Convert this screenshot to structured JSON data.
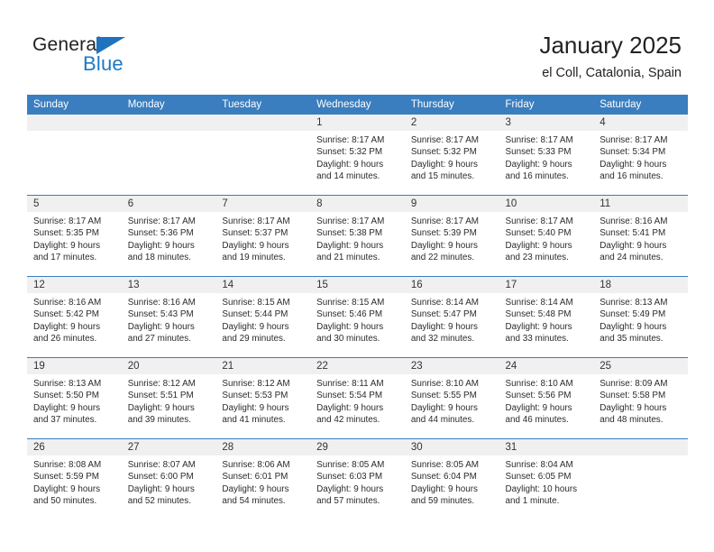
{
  "logo": {
    "word_top": "General",
    "word_bottom": "Blue",
    "triangle_color": "#1f72bd",
    "blue_text_color": "#1b79c4"
  },
  "header": {
    "title": "January 2025",
    "subtitle": "el Coll, Catalonia, Spain",
    "header_bg_color": "#3a7ebf",
    "daynum_bg_color": "#f0f0f0"
  },
  "weekday_headers": [
    "Sunday",
    "Monday",
    "Tuesday",
    "Wednesday",
    "Thursday",
    "Friday",
    "Saturday"
  ],
  "weeks": [
    [
      {
        "day": "",
        "lines": []
      },
      {
        "day": "",
        "lines": []
      },
      {
        "day": "",
        "lines": []
      },
      {
        "day": "1",
        "lines": [
          "Sunrise: 8:17 AM",
          "Sunset: 5:32 PM",
          "Daylight: 9 hours",
          "and 14 minutes."
        ]
      },
      {
        "day": "2",
        "lines": [
          "Sunrise: 8:17 AM",
          "Sunset: 5:32 PM",
          "Daylight: 9 hours",
          "and 15 minutes."
        ]
      },
      {
        "day": "3",
        "lines": [
          "Sunrise: 8:17 AM",
          "Sunset: 5:33 PM",
          "Daylight: 9 hours",
          "and 16 minutes."
        ]
      },
      {
        "day": "4",
        "lines": [
          "Sunrise: 8:17 AM",
          "Sunset: 5:34 PM",
          "Daylight: 9 hours",
          "and 16 minutes."
        ]
      }
    ],
    [
      {
        "day": "5",
        "lines": [
          "Sunrise: 8:17 AM",
          "Sunset: 5:35 PM",
          "Daylight: 9 hours",
          "and 17 minutes."
        ]
      },
      {
        "day": "6",
        "lines": [
          "Sunrise: 8:17 AM",
          "Sunset: 5:36 PM",
          "Daylight: 9 hours",
          "and 18 minutes."
        ]
      },
      {
        "day": "7",
        "lines": [
          "Sunrise: 8:17 AM",
          "Sunset: 5:37 PM",
          "Daylight: 9 hours",
          "and 19 minutes."
        ]
      },
      {
        "day": "8",
        "lines": [
          "Sunrise: 8:17 AM",
          "Sunset: 5:38 PM",
          "Daylight: 9 hours",
          "and 21 minutes."
        ]
      },
      {
        "day": "9",
        "lines": [
          "Sunrise: 8:17 AM",
          "Sunset: 5:39 PM",
          "Daylight: 9 hours",
          "and 22 minutes."
        ]
      },
      {
        "day": "10",
        "lines": [
          "Sunrise: 8:17 AM",
          "Sunset: 5:40 PM",
          "Daylight: 9 hours",
          "and 23 minutes."
        ]
      },
      {
        "day": "11",
        "lines": [
          "Sunrise: 8:16 AM",
          "Sunset: 5:41 PM",
          "Daylight: 9 hours",
          "and 24 minutes."
        ]
      }
    ],
    [
      {
        "day": "12",
        "lines": [
          "Sunrise: 8:16 AM",
          "Sunset: 5:42 PM",
          "Daylight: 9 hours",
          "and 26 minutes."
        ]
      },
      {
        "day": "13",
        "lines": [
          "Sunrise: 8:16 AM",
          "Sunset: 5:43 PM",
          "Daylight: 9 hours",
          "and 27 minutes."
        ]
      },
      {
        "day": "14",
        "lines": [
          "Sunrise: 8:15 AM",
          "Sunset: 5:44 PM",
          "Daylight: 9 hours",
          "and 29 minutes."
        ]
      },
      {
        "day": "15",
        "lines": [
          "Sunrise: 8:15 AM",
          "Sunset: 5:46 PM",
          "Daylight: 9 hours",
          "and 30 minutes."
        ]
      },
      {
        "day": "16",
        "lines": [
          "Sunrise: 8:14 AM",
          "Sunset: 5:47 PM",
          "Daylight: 9 hours",
          "and 32 minutes."
        ]
      },
      {
        "day": "17",
        "lines": [
          "Sunrise: 8:14 AM",
          "Sunset: 5:48 PM",
          "Daylight: 9 hours",
          "and 33 minutes."
        ]
      },
      {
        "day": "18",
        "lines": [
          "Sunrise: 8:13 AM",
          "Sunset: 5:49 PM",
          "Daylight: 9 hours",
          "and 35 minutes."
        ]
      }
    ],
    [
      {
        "day": "19",
        "lines": [
          "Sunrise: 8:13 AM",
          "Sunset: 5:50 PM",
          "Daylight: 9 hours",
          "and 37 minutes."
        ]
      },
      {
        "day": "20",
        "lines": [
          "Sunrise: 8:12 AM",
          "Sunset: 5:51 PM",
          "Daylight: 9 hours",
          "and 39 minutes."
        ]
      },
      {
        "day": "21",
        "lines": [
          "Sunrise: 8:12 AM",
          "Sunset: 5:53 PM",
          "Daylight: 9 hours",
          "and 41 minutes."
        ]
      },
      {
        "day": "22",
        "lines": [
          "Sunrise: 8:11 AM",
          "Sunset: 5:54 PM",
          "Daylight: 9 hours",
          "and 42 minutes."
        ]
      },
      {
        "day": "23",
        "lines": [
          "Sunrise: 8:10 AM",
          "Sunset: 5:55 PM",
          "Daylight: 9 hours",
          "and 44 minutes."
        ]
      },
      {
        "day": "24",
        "lines": [
          "Sunrise: 8:10 AM",
          "Sunset: 5:56 PM",
          "Daylight: 9 hours",
          "and 46 minutes."
        ]
      },
      {
        "day": "25",
        "lines": [
          "Sunrise: 8:09 AM",
          "Sunset: 5:58 PM",
          "Daylight: 9 hours",
          "and 48 minutes."
        ]
      }
    ],
    [
      {
        "day": "26",
        "lines": [
          "Sunrise: 8:08 AM",
          "Sunset: 5:59 PM",
          "Daylight: 9 hours",
          "and 50 minutes."
        ]
      },
      {
        "day": "27",
        "lines": [
          "Sunrise: 8:07 AM",
          "Sunset: 6:00 PM",
          "Daylight: 9 hours",
          "and 52 minutes."
        ]
      },
      {
        "day": "28",
        "lines": [
          "Sunrise: 8:06 AM",
          "Sunset: 6:01 PM",
          "Daylight: 9 hours",
          "and 54 minutes."
        ]
      },
      {
        "day": "29",
        "lines": [
          "Sunrise: 8:05 AM",
          "Sunset: 6:03 PM",
          "Daylight: 9 hours",
          "and 57 minutes."
        ]
      },
      {
        "day": "30",
        "lines": [
          "Sunrise: 8:05 AM",
          "Sunset: 6:04 PM",
          "Daylight: 9 hours",
          "and 59 minutes."
        ]
      },
      {
        "day": "31",
        "lines": [
          "Sunrise: 8:04 AM",
          "Sunset: 6:05 PM",
          "Daylight: 10 hours",
          "and 1 minute."
        ]
      },
      {
        "day": "",
        "lines": []
      }
    ]
  ]
}
